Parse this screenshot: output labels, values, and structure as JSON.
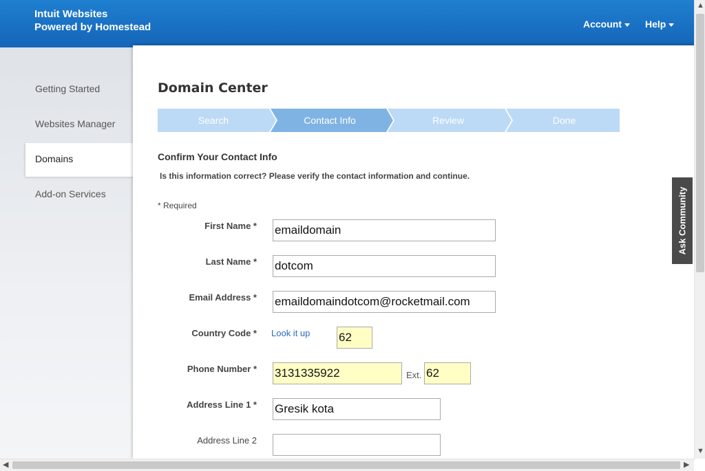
{
  "header": {
    "brand_line1": "Intuit Websites",
    "brand_line2": "Powered by Homestead",
    "account_label": "Account",
    "help_label": "Help"
  },
  "sidebar": {
    "items": [
      {
        "label": "Getting Started"
      },
      {
        "label": "Websites Manager"
      },
      {
        "label": "Domains"
      },
      {
        "label": "Add-on Services"
      }
    ]
  },
  "main": {
    "title": "Domain Center",
    "steps": [
      {
        "label": "Search"
      },
      {
        "label": "Contact Info"
      },
      {
        "label": "Review"
      },
      {
        "label": "Done"
      }
    ],
    "section_heading": "Confirm Your Contact Info",
    "intro": "Is this information correct? Please verify the contact information and continue.",
    "required_note": "* Required",
    "form": {
      "first_name": {
        "label": "First Name *",
        "value": "emaildomain"
      },
      "last_name": {
        "label": "Last Name *",
        "value": "dotcom"
      },
      "email": {
        "label": "Email Address *",
        "value": "emaildomaindotcom@rocketmail.com"
      },
      "country_code": {
        "label": "Country Code *",
        "link": "Look it up",
        "value": "62"
      },
      "phone": {
        "label": "Phone Number *",
        "value": "3131335922",
        "ext_label": "Ext.",
        "ext_value": "62"
      },
      "address1": {
        "label": "Address Line 1 *",
        "value": "Gresik kota"
      },
      "address2": {
        "label": "Address Line 2",
        "value": ""
      }
    }
  },
  "ask_community": "Ask Community",
  "colors": {
    "header_blue": "#1a72c4",
    "step_active": "#7fb3e3",
    "step_inactive": "#bcdaf5",
    "autofill_yellow": "#ffffc5"
  }
}
